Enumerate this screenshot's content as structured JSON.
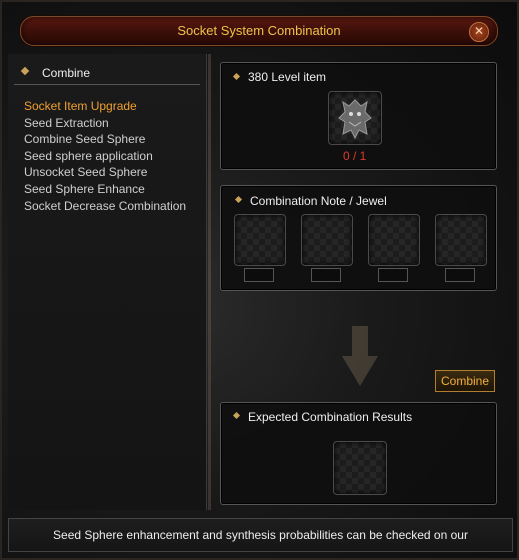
{
  "window": {
    "title": "Socket System Combination",
    "close_glyph": "✕"
  },
  "sidebar": {
    "header": "Combine",
    "items": [
      {
        "label": "Socket Item Upgrade",
        "active": true
      },
      {
        "label": "Seed Extraction",
        "active": false
      },
      {
        "label": "Combine Seed Sphere",
        "active": false
      },
      {
        "label": "Seed sphere application",
        "active": false
      },
      {
        "label": "Unsocket Seed Sphere",
        "active": false
      },
      {
        "label": "Seed Sphere Enhance",
        "active": false
      },
      {
        "label": "Socket Decrease Combination",
        "active": false
      }
    ]
  },
  "item_section": {
    "label": "380 Level item",
    "count": "0 / 1",
    "item_icon": "demon-armor-icon"
  },
  "jewel_section": {
    "label": "Combination Note / Jewel",
    "slot_count": 4
  },
  "combine_button": "Combine",
  "result_section": {
    "label": "Expected Combination Results"
  },
  "footer": {
    "text": "Seed Sphere enhancement and synthesis probabilities can be checked on our"
  },
  "colors": {
    "accent_gold": "#f0c24a",
    "active_menu": "#f0a030",
    "count_red": "#e03a2a"
  }
}
